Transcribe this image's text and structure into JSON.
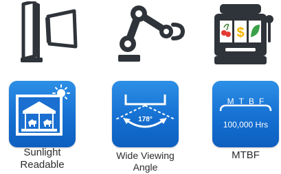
{
  "features": [
    {
      "caption_line1": "Sunlight",
      "caption_line2": "Readable"
    },
    {
      "caption_line1": "Wide Viewing",
      "caption_line2": "Angle",
      "angle_value": "178°"
    },
    {
      "caption_line1": "MTBF",
      "mtbf_letters": "MTBF",
      "mtbf_value": "100,000 Hrs"
    }
  ],
  "icons": {
    "top_row": [
      "kiosk-display-icon",
      "robot-arm-icon",
      "slot-machine-icon"
    ],
    "tiles": [
      "sunlight-readable-icon",
      "viewing-angle-icon",
      "mtbf-icon"
    ]
  },
  "colors": {
    "tile_blue": "#1570d2",
    "icon_dark": "#2f343a",
    "cherry_red": "#e53935",
    "dollar_yellow": "#f5b400",
    "leaf_green": "#3aa14a"
  }
}
